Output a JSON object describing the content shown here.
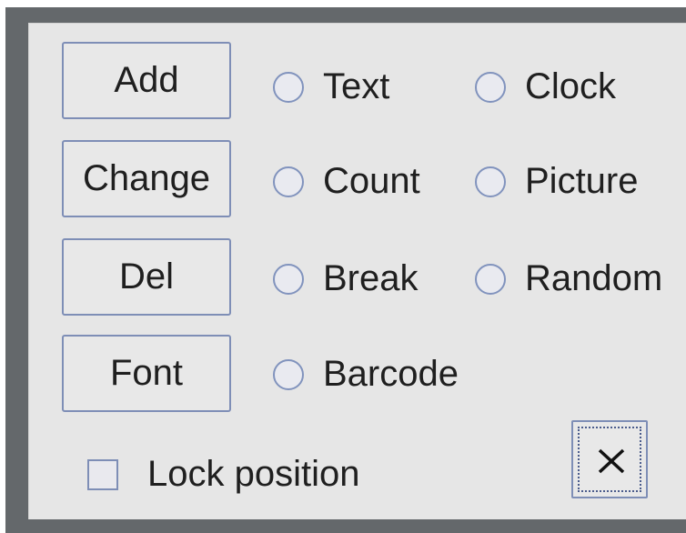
{
  "buttons": {
    "add": "Add",
    "change": "Change",
    "del": "Del",
    "font": "Font"
  },
  "radios": {
    "text": "Text",
    "clock": "Clock",
    "count": "Count",
    "picture": "Picture",
    "break": "Break",
    "random": "Random",
    "barcode": "Barcode"
  },
  "lock_position": {
    "label": "Lock position",
    "checked": false
  },
  "close": {
    "icon": "close-icon"
  }
}
